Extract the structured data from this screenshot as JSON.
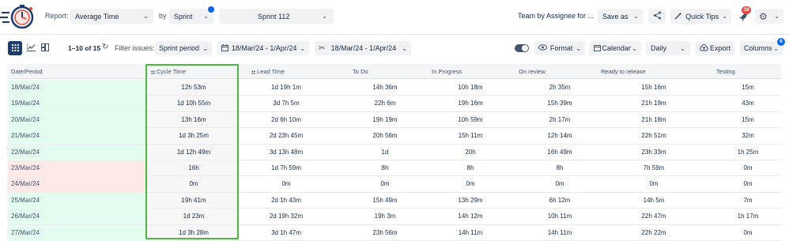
{
  "header": {
    "report_label": "Report:",
    "report_value": "Average Time",
    "by_label": "by",
    "by_value": "Sprint",
    "sprint_value": "Sprint 112",
    "team_label": "Team by Assignee for ...",
    "save_as": "Save as",
    "quick_tips": "Quick Tips",
    "notification_count": "28"
  },
  "toolbar": {
    "pagination": "1–10 of 15",
    "filter_label": "Filter issues:",
    "filter_value": "Sprint period",
    "date_range": "18/Mar/24 - 1/Apr/24",
    "date_range_2": "18/Mar/24 - 1/Apr/24",
    "format": "Format",
    "calendar": "Calendar",
    "granularity": "Daily",
    "export": "Export",
    "columns": "Columns",
    "columns_badge": "6"
  },
  "table": {
    "columns": [
      "Date/Period",
      "Cycle Time",
      "Lead Time",
      "To Do",
      "In Progress",
      "On review",
      "Ready to release",
      "Testing"
    ],
    "rows": [
      {
        "date": "18/Mar/24",
        "status": "green",
        "values": [
          "12h 53m",
          "1d 19h 1m",
          "14h 36m",
          "10h 18m",
          "2h 35m",
          "15h 16m",
          "15m"
        ]
      },
      {
        "date": "19/Mar/24",
        "status": "green",
        "values": [
          "1d 10h 55m",
          "3d 7h 5m",
          "22h 6m",
          "19h 16m",
          "15h 39m",
          "21h 19m",
          "43m"
        ]
      },
      {
        "date": "20/Mar/24",
        "status": "green",
        "values": [
          "13h 16m",
          "2d 6h 10m",
          "19h 19m",
          "10h 59m",
          "2h 17m",
          "21h 18m",
          "15m"
        ]
      },
      {
        "date": "21/Mar/24",
        "status": "green",
        "values": [
          "1d 3h 25m",
          "2d 23h 45m",
          "20h 56m",
          "15h 11m",
          "12h 14m",
          "22h 51m",
          "32m"
        ]
      },
      {
        "date": "22/Mar/24",
        "status": "green",
        "values": [
          "1d 12h 49m",
          "3d 13h 48m",
          "1d",
          "20h",
          "16h 49m",
          "23h 33m",
          "1h 25m"
        ]
      },
      {
        "date": "23/Mar/24",
        "status": "red",
        "values": [
          "16h",
          "1d 7h 59m",
          "8h",
          "8h",
          "8h",
          "7h 59m",
          "0m"
        ]
      },
      {
        "date": "24/Mar/24",
        "status": "red",
        "values": [
          "0m",
          "0m",
          "0m",
          "0m",
          "0m",
          "0m",
          "0m"
        ]
      },
      {
        "date": "25/Mar/24",
        "status": "green",
        "values": [
          "19h 41m",
          "2d 1h 43m",
          "15h 49m",
          "13h 29m",
          "6h 12m",
          "14h 5m",
          "7m"
        ]
      },
      {
        "date": "26/Mar/24",
        "status": "green",
        "values": [
          "1d 23m",
          "2d 19h 32m",
          "19h 3m",
          "14h 12m",
          "10h 11m",
          "22h 47m",
          "1h 17m"
        ]
      },
      {
        "date": "27/Mar/24",
        "status": "green",
        "values": [
          "1d 3h 28m",
          "3d 1h 47m",
          "23h 56m",
          "14h 11m",
          "14h 11m",
          "22h 22m",
          "0m"
        ]
      }
    ]
  },
  "colors": {
    "accent": "#0c66e4",
    "highlight": "#4cb944",
    "positive_row": "#e3fcef",
    "negative_row": "#ffe8e8",
    "badge": "#e2483d"
  }
}
